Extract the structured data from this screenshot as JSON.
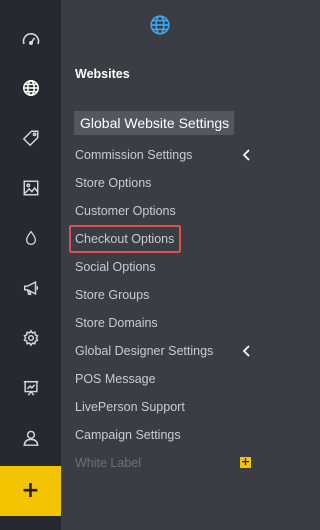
{
  "rail": {
    "items": [
      {
        "icon": "dashboard-gauge-icon"
      },
      {
        "icon": "globe-icon",
        "active": true
      },
      {
        "icon": "tag-icon"
      },
      {
        "icon": "image-icon"
      },
      {
        "icon": "water-drop-icon"
      },
      {
        "icon": "megaphone-icon"
      },
      {
        "icon": "gear-icon"
      },
      {
        "icon": "presentation-icon"
      },
      {
        "icon": "user-icon"
      }
    ],
    "add_label": "+",
    "accent_color": "#f5c400"
  },
  "panel": {
    "top_icon": "globe-icon",
    "title": "Websites",
    "header": "Global Website Settings",
    "items": [
      {
        "label": "Commission Settings",
        "has_submenu": true
      },
      {
        "label": "Store Options"
      },
      {
        "label": "Customer Options"
      },
      {
        "label": "Checkout Options",
        "highlighted": true
      },
      {
        "label": "Social Options"
      },
      {
        "label": "Store Groups"
      },
      {
        "label": "Store Domains"
      },
      {
        "label": "Global Designer Settings",
        "has_submenu": true
      },
      {
        "label": "POS Message"
      },
      {
        "label": "LivePerson Support"
      },
      {
        "label": "Campaign Settings"
      },
      {
        "label": "White Label",
        "disabled": true,
        "badge": "+"
      }
    ],
    "highlight_color": "#d9534f",
    "globe_color": "#3ea6f0"
  }
}
